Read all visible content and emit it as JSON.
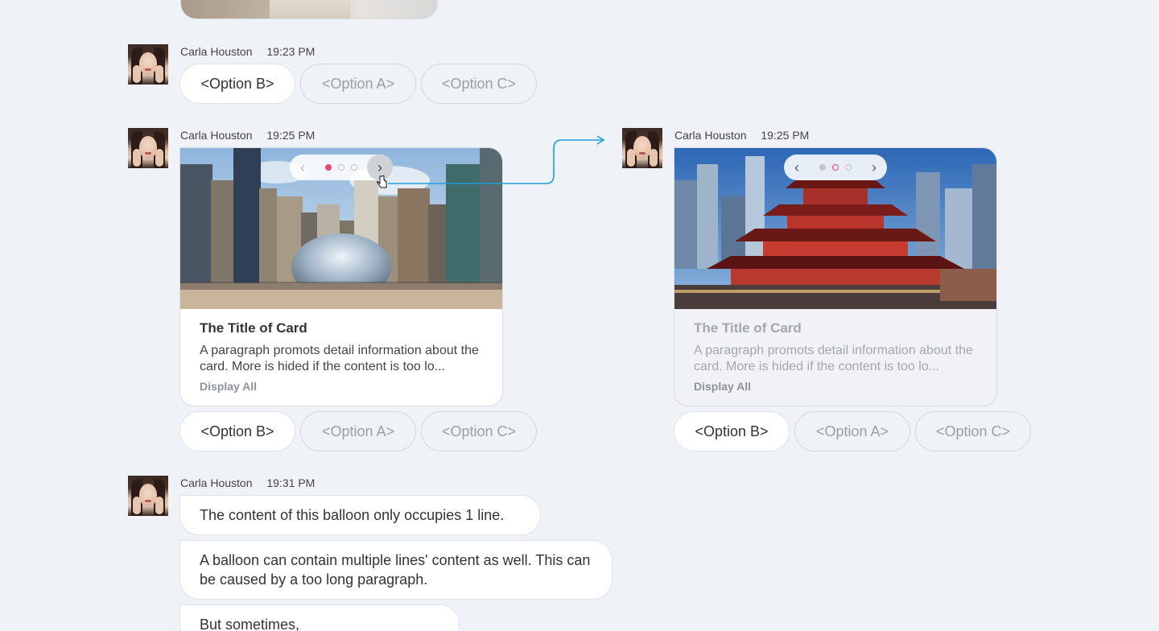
{
  "messages": [
    {
      "sender": "Carla Houston",
      "time": "19:23 PM",
      "options": [
        "<Option B>",
        "<Option A>",
        "<Option C>"
      ]
    },
    {
      "sender": "Carla Houston",
      "time": "19:25 PM",
      "card": {
        "title": "The Title of Card",
        "description": "A paragraph promots detail information about the card. More is hided if the content is too lo...",
        "display_all": "Display All",
        "pager": {
          "prev": "‹",
          "next": "›",
          "active_page": 1,
          "total_pages": 3
        }
      },
      "options": [
        "<Option B>",
        "<Option A>",
        "<Option C>"
      ]
    },
    {
      "sender": "Carla Houston",
      "time": "19:25 PM",
      "card": {
        "title": "The Title of Card",
        "description": "A paragraph promots detail information about the card. More is hided if the content is too lo...",
        "display_all": "Display All",
        "pager": {
          "prev": "‹",
          "next": "›",
          "active_page": 2,
          "total_pages": 3
        }
      },
      "options": [
        "<Option B>",
        "<Option A>",
        "<Option C>"
      ]
    },
    {
      "sender": "Carla Houston",
      "time": "19:31 PM",
      "balloons": [
        "The content of this balloon only occupies 1 line.",
        "A balloon can contain multiple lines' content as well. This can be caused by a too long paragraph.",
        "But sometimes,"
      ]
    }
  ],
  "colors": {
    "background": "#eff2f6",
    "accent_pink": "#e8476e",
    "connector_blue": "#1a9fd9"
  }
}
